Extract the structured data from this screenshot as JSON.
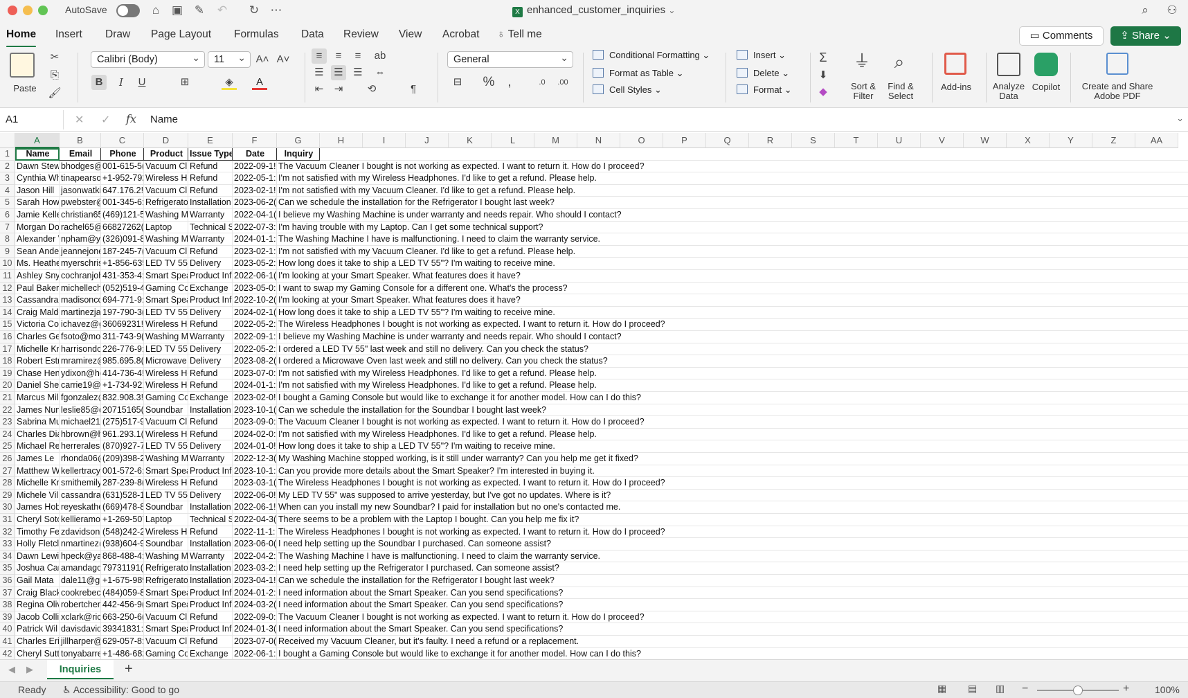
{
  "titlebar": {
    "autosave_label": "AutoSave",
    "doc_title": "enhanced_customer_inquiries",
    "icons": [
      "home-icon",
      "save-icon",
      "save-as-icon",
      "undo-icon",
      "redo-icon",
      "more-icon",
      "search-icon",
      "account-icon"
    ]
  },
  "tabs": [
    "Home",
    "Insert",
    "Draw",
    "Page Layout",
    "Formulas",
    "Data",
    "Review",
    "View",
    "Acrobat"
  ],
  "tell_me": "Tell me",
  "comments_label": "Comments",
  "share_label": "Share",
  "ribbon": {
    "paste": "Paste",
    "font_name": "Calibri (Body)",
    "font_size": "11",
    "number_format": "General",
    "conditional_formatting": "Conditional Formatting",
    "format_as_table": "Format as Table",
    "cell_styles": "Cell Styles",
    "insert": "Insert",
    "delete": "Delete",
    "format": "Format",
    "sort_filter": [
      "Sort &",
      "Filter"
    ],
    "find_select": [
      "Find &",
      "Select"
    ],
    "add_ins": "Add-ins",
    "analyze_data": [
      "Analyze",
      "Data"
    ],
    "copilot": "Copilot",
    "adobe_pdf": [
      "Create and Share",
      "Adobe PDF"
    ]
  },
  "formula_bar": {
    "cell_ref": "A1",
    "fx": "fx",
    "value": "Name"
  },
  "columns": [
    "A",
    "B",
    "C",
    "D",
    "E",
    "F",
    "G",
    "H",
    "I",
    "J",
    "K",
    "L",
    "M",
    "N",
    "O",
    "P",
    "Q",
    "R",
    "S",
    "T",
    "U",
    "V",
    "W",
    "X",
    "Y",
    "Z",
    "AA"
  ],
  "header_row": [
    "Name",
    "Email",
    "Phone",
    "Product",
    "Issue Type",
    "Date",
    "Inquiry"
  ],
  "rows": [
    [
      "Dawn Stew",
      "bhodges@l",
      "001-615-5(",
      "Vacuum Cl",
      "Refund",
      "2022-09-1!",
      "The Vacuum Cleaner I bought is not working as expected. I want to return it. How do I proceed?"
    ],
    [
      "Cynthia Wh",
      "tinapearsor",
      "+1-952-792",
      "Wireless He",
      "Refund",
      "2022-05-1:",
      "I'm not satisfied with my Wireless Headphones. I'd like to get a refund. Please help."
    ],
    [
      "Jason Hill",
      "jasonwatki",
      "647.176.2!",
      "Vacuum Cl",
      "Refund",
      "2023-02-1!",
      "I'm not satisfied with my Vacuum Cleaner. I'd like to get a refund. Please help."
    ],
    [
      "Sarah Howa",
      "pwebster@",
      "001-345-6:",
      "Refrigerato",
      "Installation",
      "2023-06-2(",
      "Can we schedule the installation for the Refrigerator I bought last week?"
    ],
    [
      "Jamie Kelle",
      "christian65",
      "(469)121-5",
      "Washing M",
      "Warranty",
      "2022-04-1(",
      "I believe my Washing Machine is under warranty and needs repair. Who should I contact?"
    ],
    [
      "Morgan Do",
      "rachel65@",
      "66827262(",
      "Laptop",
      "Technical S",
      "2022-07-3:",
      "I'm having trouble with my Laptop. Can I get some technical support?"
    ],
    [
      "Alexander V",
      "npham@ya",
      "(326)091-8",
      "Washing M",
      "Warranty",
      "2024-01-1:",
      "The Washing Machine I have is malfunctioning. I need to claim the warranty service."
    ],
    [
      "Sean Ander",
      "jeannejone",
      "187-245-7(",
      "Vacuum Cl",
      "Refund",
      "2023-02-1:",
      "I'm not satisfied with my Vacuum Cleaner. I'd like to get a refund. Please help."
    ],
    [
      "Ms. Heathe",
      "myerschris",
      "+1-856-635",
      "LED TV 55\"",
      "Delivery",
      "2023-05-2:",
      "How long does it take to ship a LED TV 55\"? I'm waiting to receive mine."
    ],
    [
      "Ashley Snyc",
      "cochranjoh",
      "431-353-4:",
      "Smart Spea",
      "Product Inf",
      "2022-06-1(",
      "I'm looking at your Smart Speaker. What features does it have?"
    ],
    [
      "Paul Baker",
      "michellech",
      "(052)519-4",
      "Gaming Co",
      "Exchange",
      "2023-05-0:",
      "I want to swap my Gaming Console for a different one. What's the process?"
    ],
    [
      "Cassandra E",
      "madisonco",
      "694-771-9:",
      "Smart Spea",
      "Product Inf",
      "2022-10-2(",
      "I'm looking at your Smart Speaker. What features does it have?"
    ],
    [
      "Craig Maldo",
      "martinezjal",
      "197-790-3(",
      "LED TV 55\"",
      "Delivery",
      "2024-02-1(",
      "How long does it take to ship a LED TV 55\"? I'm waiting to receive mine."
    ],
    [
      "Victoria Co",
      "ichavez@gr",
      "36069231!",
      "Wireless He",
      "Refund",
      "2022-05-2:",
      "The Wireless Headphones I bought is not working as expected. I want to return it. How do I proceed?"
    ],
    [
      "Charles Gec",
      "fsoto@mor",
      "311-743-9(",
      "Washing M",
      "Warranty",
      "2022-09-1:",
      "I believe my Washing Machine is under warranty and needs repair. Who should I contact?"
    ],
    [
      "Michelle Kr",
      "harrisondo",
      "226-776-9:",
      "LED TV 55\"",
      "Delivery",
      "2022-05-2:",
      "I ordered a LED TV 55\" last week and still no delivery. Can you check the status?"
    ],
    [
      "Robert Estr",
      "mramirez@",
      "985.695.8(",
      "Microwave",
      "Delivery",
      "2023-08-2(",
      "I ordered a Microwave Oven last week and still no delivery. Can you check the status?"
    ],
    [
      "Chase Hens",
      "ydixon@hc",
      "414-736-4!",
      "Wireless He",
      "Refund",
      "2023-07-0:",
      "I'm not satisfied with my Wireless Headphones. I'd like to get a refund. Please help."
    ],
    [
      "Daniel Shep",
      "carrie19@y",
      "+1-734-921",
      "Wireless He",
      "Refund",
      "2024-01-1:",
      "I'm not satisfied with my Wireless Headphones. I'd like to get a refund. Please help."
    ],
    [
      "Marcus Mil",
      "fgonzalez@",
      "832.908.3!",
      "Gaming Co",
      "Exchange",
      "2023-02-0!",
      "I bought a Gaming Console but would like to exchange it for another model. How can I do this?"
    ],
    [
      "James Nune",
      "leslie85@d",
      "20715165(",
      "Soundbar",
      "Installation",
      "2023-10-1(",
      "Can we schedule the installation for the Soundbar I bought last week?"
    ],
    [
      "Sabrina Mu",
      "michael21(",
      "(275)517-9",
      "Vacuum Cl",
      "Refund",
      "2023-09-0:",
      "The Vacuum Cleaner I bought is not working as expected. I want to return it. How do I proceed?"
    ],
    [
      "Charles Dia",
      "hbrown@h",
      "961.293.1(",
      "Wireless He",
      "Refund",
      "2024-02-0:",
      "I'm not satisfied with my Wireless Headphones. I'd like to get a refund. Please help."
    ],
    [
      "Michael Re",
      "herreralesli",
      "(870)927-7",
      "LED TV 55\"",
      "Delivery",
      "2024-01-0!",
      "How long does it take to ship a LED TV 55\"? I'm waiting to receive mine."
    ],
    [
      "James Le",
      "rhonda06@",
      "(209)398-2",
      "Washing M",
      "Warranty",
      "2022-12-3(",
      "My Washing Machine stopped working, is it still under warranty? Can you help me get it fixed?"
    ],
    [
      "Matthew W",
      "kellertracy(",
      "001-572-6:",
      "Smart Spea",
      "Product Inf",
      "2023-10-1:",
      "Can you provide more details about the Smart Speaker? I'm interested in buying it."
    ],
    [
      "Michelle Kr",
      "smithemily",
      "287-239-8(",
      "Wireless He",
      "Refund",
      "2023-03-1(",
      "The Wireless Headphones I bought is not working as expected. I want to return it. How do I proceed?"
    ],
    [
      "Michele Vil",
      "cassandrap",
      "(631)528-1",
      "LED TV 55\"",
      "Delivery",
      "2022-06-0!",
      "My LED TV 55\" was supposed to arrive yesterday, but I've got no updates. Where is it?"
    ],
    [
      "James Hobl",
      "reyeskathe",
      "(669)478-8",
      "Soundbar",
      "Installation",
      "2022-06-1!",
      "When can you install my new Soundbar? I paid for installation but no one's contacted me."
    ],
    [
      "Cheryl Soto",
      "kellieramos",
      "+1-269-507",
      "Laptop",
      "Technical S",
      "2022-04-3(",
      "There seems to be a problem with the Laptop I bought. Can you help me fix it?"
    ],
    [
      "Timothy Fe",
      "zdavidson@",
      "(548)242-2",
      "Wireless He",
      "Refund",
      "2022-11-1:",
      "The Wireless Headphones I bought is not working as expected. I want to return it. How do I proceed?"
    ],
    [
      "Holly Fletcl",
      "nmartinez@",
      "(938)604-9",
      "Soundbar",
      "Installation",
      "2023-06-0(",
      "I need help setting up the Soundbar I purchased. Can someone assist?"
    ],
    [
      "Dawn Lewi:",
      "hpeck@yal",
      "868-488-4:",
      "Washing M",
      "Warranty",
      "2022-04-2:",
      "The Washing Machine I have is malfunctioning. I need to claim the warranty service."
    ],
    [
      "Joshua Carr",
      "amandagor",
      "79731191(",
      "Refrigerato",
      "Installation",
      "2023-03-2:",
      "I need help setting up the Refrigerator I purchased. Can someone assist?"
    ],
    [
      "Gail Mata",
      "dale11@gr",
      "+1-675-989",
      "Refrigerato",
      "Installation",
      "2023-04-1!",
      "Can we schedule the installation for the Refrigerator I bought last week?"
    ],
    [
      "Craig Black",
      "cookrebecc",
      "(484)059-8",
      "Smart Spea",
      "Product Inf",
      "2024-01-2:",
      "I need information about the Smart Speaker. Can you send specifications?"
    ],
    [
      "Regina Oliv",
      "robertchen",
      "442-456-9(",
      "Smart Spea",
      "Product Inf",
      "2024-03-2(",
      "I need information about the Smart Speaker. Can you send specifications?"
    ],
    [
      "Jacob Colli",
      "xclark@ric",
      "663-250-6(",
      "Vacuum Cl",
      "Refund",
      "2022-09-0:",
      "The Vacuum Cleaner I bought is not working as expected. I want to return it. How do I proceed?"
    ],
    [
      "Patrick Wil",
      "davisdavid(",
      "39341831:",
      "Smart Spea",
      "Product Inf",
      "2024-01-3(",
      "I need information about the Smart Speaker. Can you send specifications?"
    ],
    [
      "Charles Eric",
      "jillharper@",
      "629-057-8:",
      "Vacuum Cl",
      "Refund",
      "2023-07-0(",
      "Received my Vacuum Cleaner, but it's faulty. I need a refund or a replacement."
    ],
    [
      "Cheryl Sutt",
      "tonyabarre",
      "+1-486-682",
      "Gaming Co",
      "Exchange",
      "2022-06-1:",
      "I bought a Gaming Console but would like to exchange it for another model. How can I do this?"
    ]
  ],
  "sheet_tab": "Inquiries",
  "status": {
    "ready": "Ready",
    "accessibility": "Accessibility: Good to go",
    "zoom": "100%"
  },
  "colors": {
    "accent": "#1f7a45",
    "chrome": "#f3f3f3"
  }
}
